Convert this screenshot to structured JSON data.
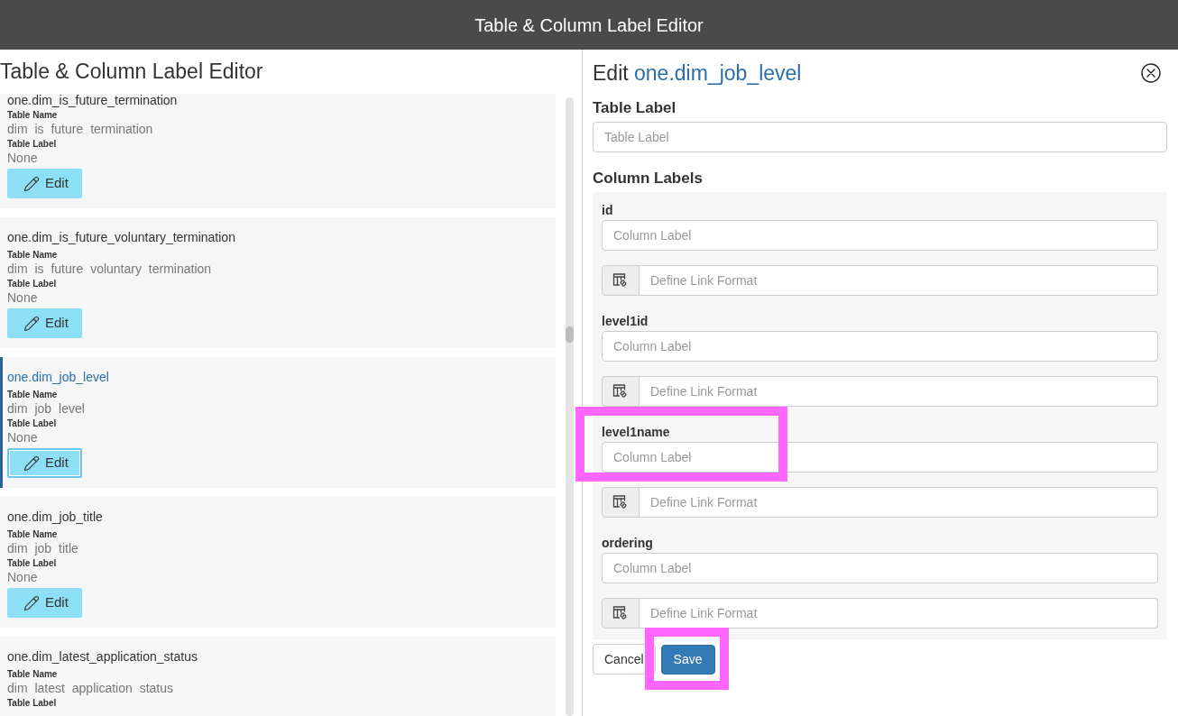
{
  "header": {
    "title": "Table & Column Label Editor"
  },
  "list_panel": {
    "title": "Table & Column Label Editor",
    "items": [
      {
        "title": "one.dim_is_future_termination",
        "name_label": "Table Name",
        "name_value": "dim is future termination",
        "label_label": "Table Label",
        "label_value": "None",
        "button": "Edit",
        "selected": false
      },
      {
        "title": "one.dim_is_future_voluntary_termination",
        "name_label": "Table Name",
        "name_value": "dim is future voluntary termination",
        "label_label": "Table Label",
        "label_value": "None",
        "button": "Edit",
        "selected": false
      },
      {
        "title": "one.dim_job_level",
        "name_label": "Table Name",
        "name_value": "dim job level",
        "label_label": "Table Label",
        "label_value": "None",
        "button": "Edit",
        "selected": true
      },
      {
        "title": "one.dim_job_title",
        "name_label": "Table Name",
        "name_value": "dim job title",
        "label_label": "Table Label",
        "label_value": "None",
        "button": "Edit",
        "selected": false
      },
      {
        "title": "one.dim_latest_application_status",
        "name_label": "Table Name",
        "name_value": "dim latest application status",
        "label_label": "Table Label",
        "selected": false
      }
    ]
  },
  "edit_panel": {
    "heading_prefix": "Edit",
    "heading_table": "one.dim_job_level",
    "table_label": {
      "label": "Table Label",
      "placeholder": "Table Label"
    },
    "column_labels_heading": "Column Labels",
    "columns": [
      {
        "name": "id",
        "label_placeholder": "Column Label",
        "link_placeholder": "Define Link Format",
        "highlighted": false
      },
      {
        "name": "level1id",
        "label_placeholder": "Column Label",
        "link_placeholder": "Define Link Format",
        "highlighted": false
      },
      {
        "name": "level1name",
        "label_placeholder": "Column Label",
        "link_placeholder": "Define Link Format",
        "highlighted": true
      },
      {
        "name": "ordering",
        "label_placeholder": "Column Label",
        "link_placeholder": "Define Link Format",
        "highlighted": false
      }
    ],
    "buttons": [
      {
        "label": "Cancel",
        "kind": "secondary",
        "highlighted": false
      },
      {
        "label": "Save",
        "kind": "primary",
        "highlighted": true
      }
    ]
  }
}
